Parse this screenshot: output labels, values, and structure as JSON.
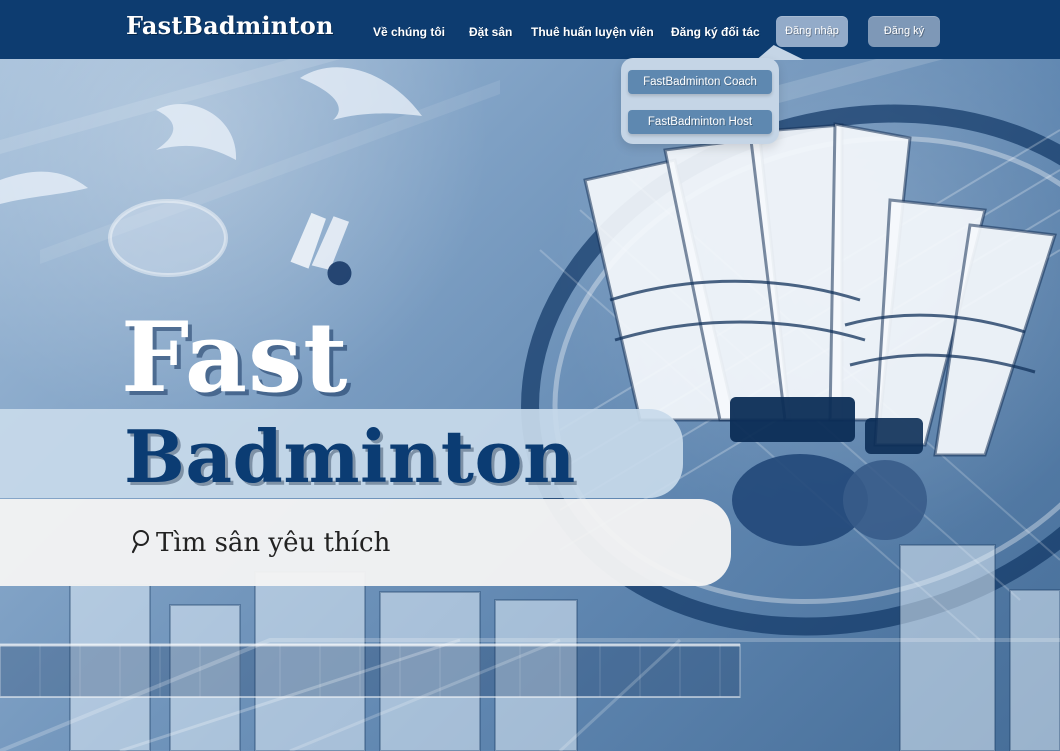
{
  "header": {
    "brand": "FastBadminton"
  },
  "nav": {
    "about": "Về chúng tôi",
    "book_court": "Đặt sân",
    "hire_coach": "Thuê huấn luyện viên",
    "partner_register": "Đăng ký đối tác"
  },
  "auth": {
    "login": "Đăng nhập",
    "signup": "Đăng ký"
  },
  "partner_dropdown": {
    "options": [
      "FastBadminton Coach",
      "FastBadminton Host"
    ]
  },
  "hero": {
    "title_line1": "Fast",
    "title_line2": "Badminton"
  },
  "search": {
    "placeholder": "Tìm sân yêu thích",
    "icon": "search-icon"
  },
  "colors": {
    "header_bg": "#0d3c70",
    "button_bg": "#7e98b7",
    "active_button_bg": "#93abc9",
    "dropdown_bg": "#c5d5e6",
    "dropdown_option_bg": "#5e88b0",
    "hero_band_bg": "#c8daea",
    "search_bg": "#f4f4f4",
    "hero_title_dark": "#0b3c73",
    "white": "#ffffff"
  }
}
